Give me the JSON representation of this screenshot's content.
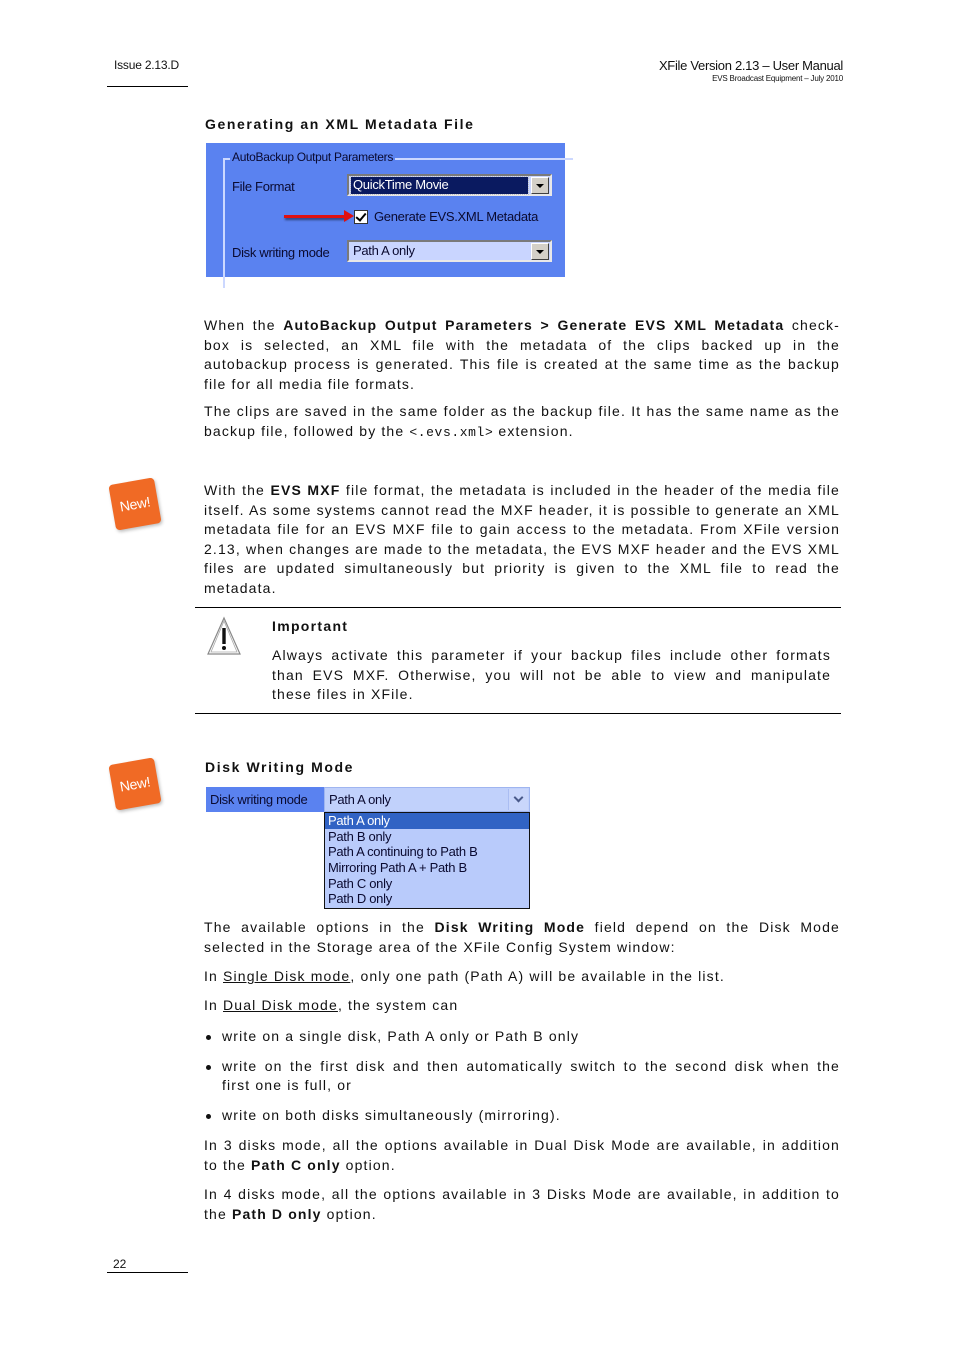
{
  "header": {
    "issue": "Issue 2.13.D",
    "title": "XFile Version 2.13 – User Manual",
    "subtitle": "EVS Broadcast Equipment – July 2010"
  },
  "section1": {
    "heading": "Generating an XML Metadata File",
    "dialog": {
      "group_title": "AutoBackup Output Parameters",
      "file_format_label": "File Format",
      "file_format_value": "QuickTime Movie",
      "checkbox_label": "Generate EVS.XML Metadata",
      "checkbox_checked": true,
      "disk_mode_label": "Disk writing mode",
      "disk_mode_value": "Path A only"
    },
    "para1": {
      "t1": "When the ",
      "b1": "AutoBackup Output Parameters > Generate EVS XML Metadata",
      "t2": " check-box is selected, an XML file with the metadata of the clips backed up in the autobackup process is generated. This file is created at the same time as the backup file for all media file formats."
    },
    "para2": {
      "t1": "The clips are saved in the same folder as the backup file. It has the same name as the backup file, followed by the ",
      "code": "<.evs.xml>",
      "t2": " extension."
    }
  },
  "new_badge_label": "New!",
  "section2": {
    "para": {
      "t1": "With the ",
      "b1": "EVS MXF",
      "t2": " file format, the metadata is included in the header of the media file itself. As some systems cannot read the MXF header, it is possible to generate an XML metadata file for an EVS MXF file to gain access to the metadata. From XFile version 2.13, when changes are made to the metadata, the EVS MXF header and the EVS XML files are updated simultaneously but priority is given to the XML file to read the metadata."
    },
    "important": {
      "title": "Important",
      "text": "Always activate this parameter if your backup files include other formats than EVS MXF. Otherwise, you will not be able to view and manipulate these files in XFile."
    }
  },
  "section3": {
    "heading": "Disk Writing Mode",
    "widget": {
      "label": "Disk writing mode",
      "value": "Path A only",
      "options": [
        "Path A only",
        "Path B only",
        "Path A continuing to Path B",
        "Mirroring Path A + Path B",
        "Path C only",
        "Path D only"
      ],
      "selected_index": 0
    },
    "para1": {
      "t1": "The available options in the ",
      "b1": "Disk Writing Mode",
      "t2": " field depend on the Disk Mode selected in the Storage area of the XFile Config System window:"
    },
    "para2": {
      "t1": "In ",
      "u1": "Single Disk mode",
      "t2": ", only one path (Path A) will be available in the list."
    },
    "para3": {
      "t1": "In ",
      "u1": "Dual Disk mode",
      "t2": ", the system can"
    },
    "bullets": [
      "write on a single disk, Path A only or Path B only",
      "write on the first disk and then automatically switch to the second disk when the first one is full, or",
      "write on both disks simultaneously (mirroring)."
    ],
    "para4": {
      "t1": "In 3 disks mode, all the options available in Dual Disk Mode are available, in addition to the ",
      "b1": "Path C only",
      "t2": " option."
    },
    "para5": {
      "t1": "In 4 disks mode, all the options available in 3 Disks Mode are available, in addition to the ",
      "b1": "Path D only",
      "t2": " option."
    }
  },
  "footer": {
    "page_number": "22"
  }
}
